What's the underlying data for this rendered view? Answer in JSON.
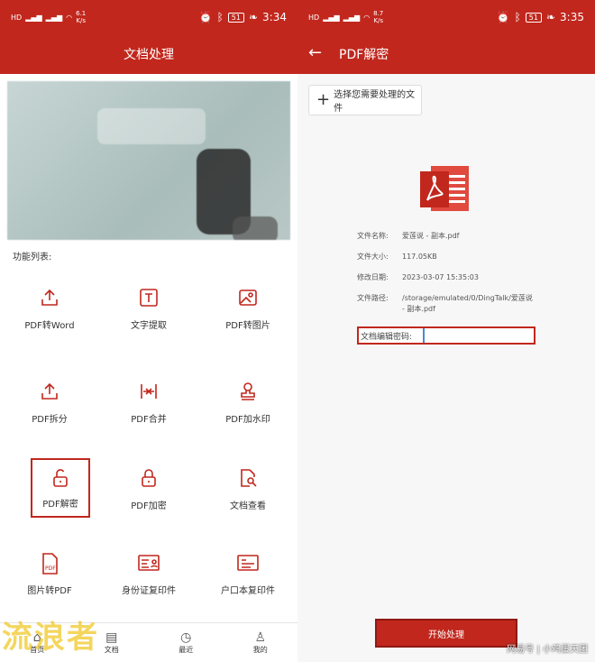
{
  "left": {
    "status": {
      "net_top": "6.1",
      "net_unit": "K/s",
      "battery": "51",
      "time": "3:34"
    },
    "title": "文档处理",
    "section_label": "功能列表:",
    "features": [
      {
        "label": "PDF转Word",
        "icon": "upload-icon"
      },
      {
        "label": "文字提取",
        "icon": "text-box-icon"
      },
      {
        "label": "PDF转图片",
        "icon": "image-icon"
      },
      {
        "label": "PDF拆分",
        "icon": "upload-split-icon"
      },
      {
        "label": "PDF合并",
        "icon": "merge-icon"
      },
      {
        "label": "PDF加水印",
        "icon": "stamp-icon"
      },
      {
        "label": "PDF解密",
        "icon": "unlock-icon"
      },
      {
        "label": "PDF加密",
        "icon": "lock-icon"
      },
      {
        "label": "文档查看",
        "icon": "doc-search-icon"
      },
      {
        "label": "图片转PDF",
        "icon": "pdf-file-icon"
      },
      {
        "label": "身份证复印件",
        "icon": "id-card-icon"
      },
      {
        "label": "户口本复印件",
        "icon": "household-book-icon"
      }
    ],
    "nav": [
      {
        "label": "首页",
        "icon": "home-icon"
      },
      {
        "label": "文档",
        "icon": "document-icon"
      },
      {
        "label": "最近",
        "icon": "clock-icon"
      },
      {
        "label": "我的",
        "icon": "user-icon"
      }
    ],
    "watermark": "流浪者",
    "accent": "#c1271d"
  },
  "right": {
    "status": {
      "net_top": "8.7",
      "net_unit": "K/s",
      "battery": "51",
      "time": "3:35"
    },
    "title": "PDF解密",
    "select_label": "选择您需要处理的文件",
    "file_info": [
      {
        "key": "文件名称:",
        "value": "爱莲说 - 副本.pdf"
      },
      {
        "key": "文件大小:",
        "value": "117.05KB"
      },
      {
        "key": "修改日期:",
        "value": "2023-03-07 15:35:03"
      },
      {
        "key": "文件路径:",
        "value": "/storage/emulated/0/DingTalk/爱莲说 - 副本.pdf"
      }
    ],
    "password_label": "文档编辑密码:",
    "password_value": "",
    "start_label": "开始处理",
    "watermark": "网易号 | 小鸡蛋天团"
  }
}
